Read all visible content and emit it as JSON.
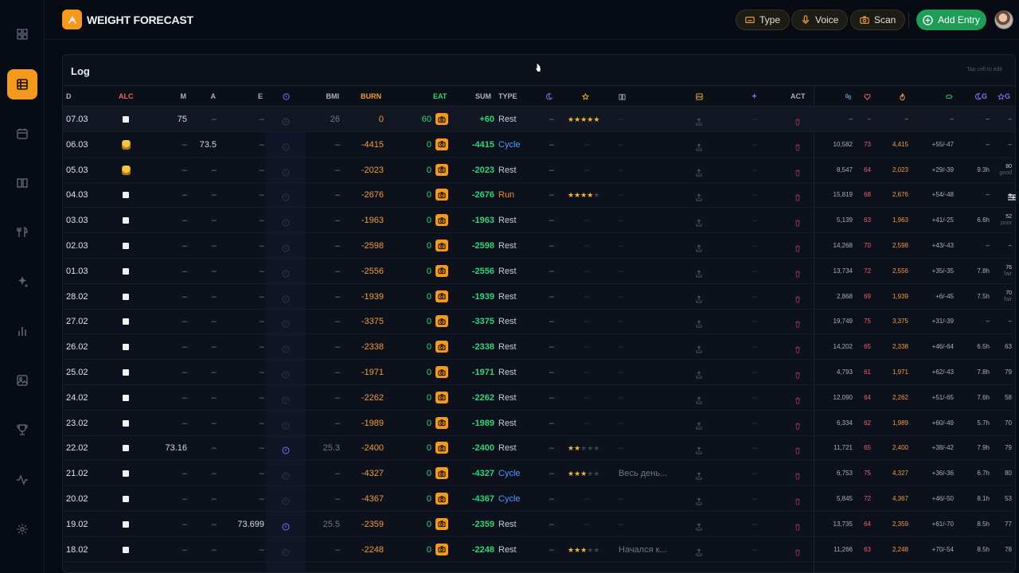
{
  "app": {
    "title": "WEIGHT FORECAST"
  },
  "toolbar": {
    "type_label": "Type",
    "voice_label": "Voice",
    "scan_label": "Scan",
    "add_label": "Add Entry"
  },
  "log": {
    "title": "Log",
    "hint": "Tap cell to edit",
    "headers": {
      "d": "D",
      "alc": "ALC",
      "m": "M",
      "a": "A",
      "e": "E",
      "bmi": "BMI",
      "burn": "BURN",
      "eat": "EAT",
      "sum": "SUM",
      "type": "TYPE",
      "act": "ACT",
      "g1": "G",
      "g2": "G"
    },
    "rows": [
      {
        "d": "07.03",
        "alc": "box",
        "m": "75",
        "a": "–",
        "e": "–",
        "bmi": "26",
        "burn": "0",
        "eat": "60",
        "sum": "+60",
        "type": "Rest",
        "sleep": "–",
        "stars": 5,
        "note": "–",
        "steps": "–",
        "hr": "–",
        "kcal": "–",
        "bal": "–",
        "sl": "–",
        "score": "–",
        "score2": ""
      },
      {
        "d": "06.03",
        "alc": "beer",
        "m": "–",
        "a": "73.5",
        "e": "–",
        "bmi": "–",
        "burn": "-4415",
        "eat": "0",
        "sum": "-4415",
        "type": "Cycle",
        "sleep": "–",
        "stars": 0,
        "note": "–",
        "steps": "10,582",
        "hr": "73",
        "kcal": "4,415",
        "bal": "+55/-47",
        "sl": "–",
        "score": "–",
        "score2": ""
      },
      {
        "d": "05.03",
        "alc": "beer",
        "m": "–",
        "a": "–",
        "e": "–",
        "bmi": "–",
        "burn": "-2023",
        "eat": "0",
        "sum": "-2023",
        "type": "Rest",
        "sleep": "–",
        "stars": 0,
        "note": "–",
        "steps": "8,547",
        "hr": "64",
        "kcal": "2,023",
        "bal": "+29/-39",
        "sl": "9.3h",
        "score": "80",
        "score2": "good"
      },
      {
        "d": "04.03",
        "alc": "box",
        "m": "–",
        "a": "–",
        "e": "–",
        "bmi": "–",
        "burn": "-2676",
        "eat": "0",
        "sum": "-2676",
        "type": "Run",
        "sleep": "–",
        "stars": 4,
        "note": "–",
        "steps": "15,819",
        "hr": "68",
        "kcal": "2,676",
        "bal": "+54/-48",
        "sl": "–",
        "score": "",
        "score2": ""
      },
      {
        "d": "03.03",
        "alc": "box",
        "m": "–",
        "a": "–",
        "e": "–",
        "bmi": "–",
        "burn": "-1963",
        "eat": "0",
        "sum": "-1963",
        "type": "Rest",
        "sleep": "–",
        "stars": 0,
        "note": "–",
        "steps": "5,139",
        "hr": "63",
        "kcal": "1,963",
        "bal": "+41/-25",
        "sl": "6.6h",
        "score": "52",
        "score2": "poor"
      },
      {
        "d": "02.03",
        "alc": "box",
        "m": "–",
        "a": "–",
        "e": "–",
        "bmi": "–",
        "burn": "-2598",
        "eat": "0",
        "sum": "-2598",
        "type": "Rest",
        "sleep": "–",
        "stars": 0,
        "note": "–",
        "steps": "14,268",
        "hr": "70",
        "kcal": "2,598",
        "bal": "+43/-43",
        "sl": "–",
        "score": "–",
        "score2": ""
      },
      {
        "d": "01.03",
        "alc": "box",
        "m": "–",
        "a": "–",
        "e": "–",
        "bmi": "–",
        "burn": "-2556",
        "eat": "0",
        "sum": "-2556",
        "type": "Rest",
        "sleep": "–",
        "stars": 0,
        "note": "–",
        "steps": "13,734",
        "hr": "72",
        "kcal": "2,556",
        "bal": "+35/-35",
        "sl": "7.8h",
        "score": "76",
        "score2": "fair"
      },
      {
        "d": "28.02",
        "alc": "box",
        "m": "–",
        "a": "–",
        "e": "–",
        "bmi": "–",
        "burn": "-1939",
        "eat": "0",
        "sum": "-1939",
        "type": "Rest",
        "sleep": "–",
        "stars": 0,
        "note": "–",
        "steps": "2,868",
        "hr": "69",
        "kcal": "1,939",
        "bal": "+6/-45",
        "sl": "7.5h",
        "score": "70",
        "score2": "fair"
      },
      {
        "d": "27.02",
        "alc": "box",
        "m": "–",
        "a": "–",
        "e": "–",
        "bmi": "–",
        "burn": "-3375",
        "eat": "0",
        "sum": "-3375",
        "type": "Rest",
        "sleep": "–",
        "stars": 0,
        "note": "–",
        "steps": "19,749",
        "hr": "75",
        "kcal": "3,375",
        "bal": "+31/-39",
        "sl": "–",
        "score": "–",
        "score2": ""
      },
      {
        "d": "26.02",
        "alc": "box",
        "m": "–",
        "a": "–",
        "e": "–",
        "bmi": "–",
        "burn": "-2338",
        "eat": "0",
        "sum": "-2338",
        "type": "Rest",
        "sleep": "–",
        "stars": 0,
        "note": "–",
        "steps": "14,202",
        "hr": "65",
        "kcal": "2,338",
        "bal": "+46/-64",
        "sl": "6.5h",
        "score": "63",
        "score2": ""
      },
      {
        "d": "25.02",
        "alc": "box",
        "m": "–",
        "a": "–",
        "e": "–",
        "bmi": "–",
        "burn": "-1971",
        "eat": "0",
        "sum": "-1971",
        "type": "Rest",
        "sleep": "–",
        "stars": 0,
        "note": "–",
        "steps": "4,793",
        "hr": "61",
        "kcal": "1,971",
        "bal": "+62/-43",
        "sl": "7.8h",
        "score": "79",
        "score2": ""
      },
      {
        "d": "24.02",
        "alc": "box",
        "m": "–",
        "a": "–",
        "e": "–",
        "bmi": "–",
        "burn": "-2262",
        "eat": "0",
        "sum": "-2262",
        "type": "Rest",
        "sleep": "–",
        "stars": 0,
        "note": "–",
        "steps": "12,090",
        "hr": "64",
        "kcal": "2,262",
        "bal": "+51/-65",
        "sl": "7.6h",
        "score": "58",
        "score2": ""
      },
      {
        "d": "23.02",
        "alc": "box",
        "m": "–",
        "a": "–",
        "e": "–",
        "bmi": "–",
        "burn": "-1989",
        "eat": "0",
        "sum": "-1989",
        "type": "Rest",
        "sleep": "–",
        "stars": 0,
        "note": "–",
        "steps": "6,334",
        "hr": "62",
        "kcal": "1,989",
        "bal": "+60/-49",
        "sl": "5.7h",
        "score": "70",
        "score2": ""
      },
      {
        "d": "22.02",
        "alc": "box",
        "m": "73.16",
        "a": "–",
        "e": "–",
        "bmi": "25.3",
        "burn": "-2400",
        "eat": "0",
        "sum": "-2400",
        "type": "Rest",
        "sleep": "–",
        "stars": 2,
        "note": "–",
        "steps": "11,721",
        "hr": "65",
        "kcal": "2,400",
        "bal": "+38/-42",
        "sl": "7.9h",
        "score": "79",
        "score2": ""
      },
      {
        "d": "21.02",
        "alc": "box",
        "m": "–",
        "a": "–",
        "e": "–",
        "bmi": "–",
        "burn": "-4327",
        "eat": "0",
        "sum": "-4327",
        "type": "Cycle",
        "sleep": "–",
        "stars": 3,
        "note": "Весь день...",
        "steps": "6,753",
        "hr": "75",
        "kcal": "4,327",
        "bal": "+36/-36",
        "sl": "6.7h",
        "score": "80",
        "score2": ""
      },
      {
        "d": "20.02",
        "alc": "box",
        "m": "–",
        "a": "–",
        "e": "–",
        "bmi": "–",
        "burn": "-4367",
        "eat": "0",
        "sum": "-4367",
        "type": "Cycle",
        "sleep": "–",
        "stars": 0,
        "note": "–",
        "steps": "5,845",
        "hr": "72",
        "kcal": "4,367",
        "bal": "+46/-50",
        "sl": "8.1h",
        "score": "53",
        "score2": ""
      },
      {
        "d": "19.02",
        "alc": "box",
        "m": "–",
        "a": "–",
        "e": "73.699",
        "bmi": "25.5",
        "burn": "-2359",
        "eat": "0",
        "sum": "-2359",
        "type": "Rest",
        "sleep": "–",
        "stars": 0,
        "note": "–",
        "steps": "13,735",
        "hr": "64",
        "kcal": "2,359",
        "bal": "+61/-70",
        "sl": "8.5h",
        "score": "77",
        "score2": ""
      },
      {
        "d": "18.02",
        "alc": "box",
        "m": "–",
        "a": "–",
        "e": "–",
        "bmi": "–",
        "burn": "-2248",
        "eat": "0",
        "sum": "-2248",
        "type": "Rest",
        "sleep": "–",
        "stars": 3,
        "note": "Начался к...",
        "steps": "11,266",
        "hr": "63",
        "kcal": "2,248",
        "bal": "+70/-54",
        "sl": "8.5h",
        "score": "78",
        "score2": ""
      }
    ]
  },
  "colors": {
    "accent": "#f39a1e",
    "green": "#34d576",
    "add_button": "#1f9d57",
    "cycle": "#4f9bff"
  }
}
